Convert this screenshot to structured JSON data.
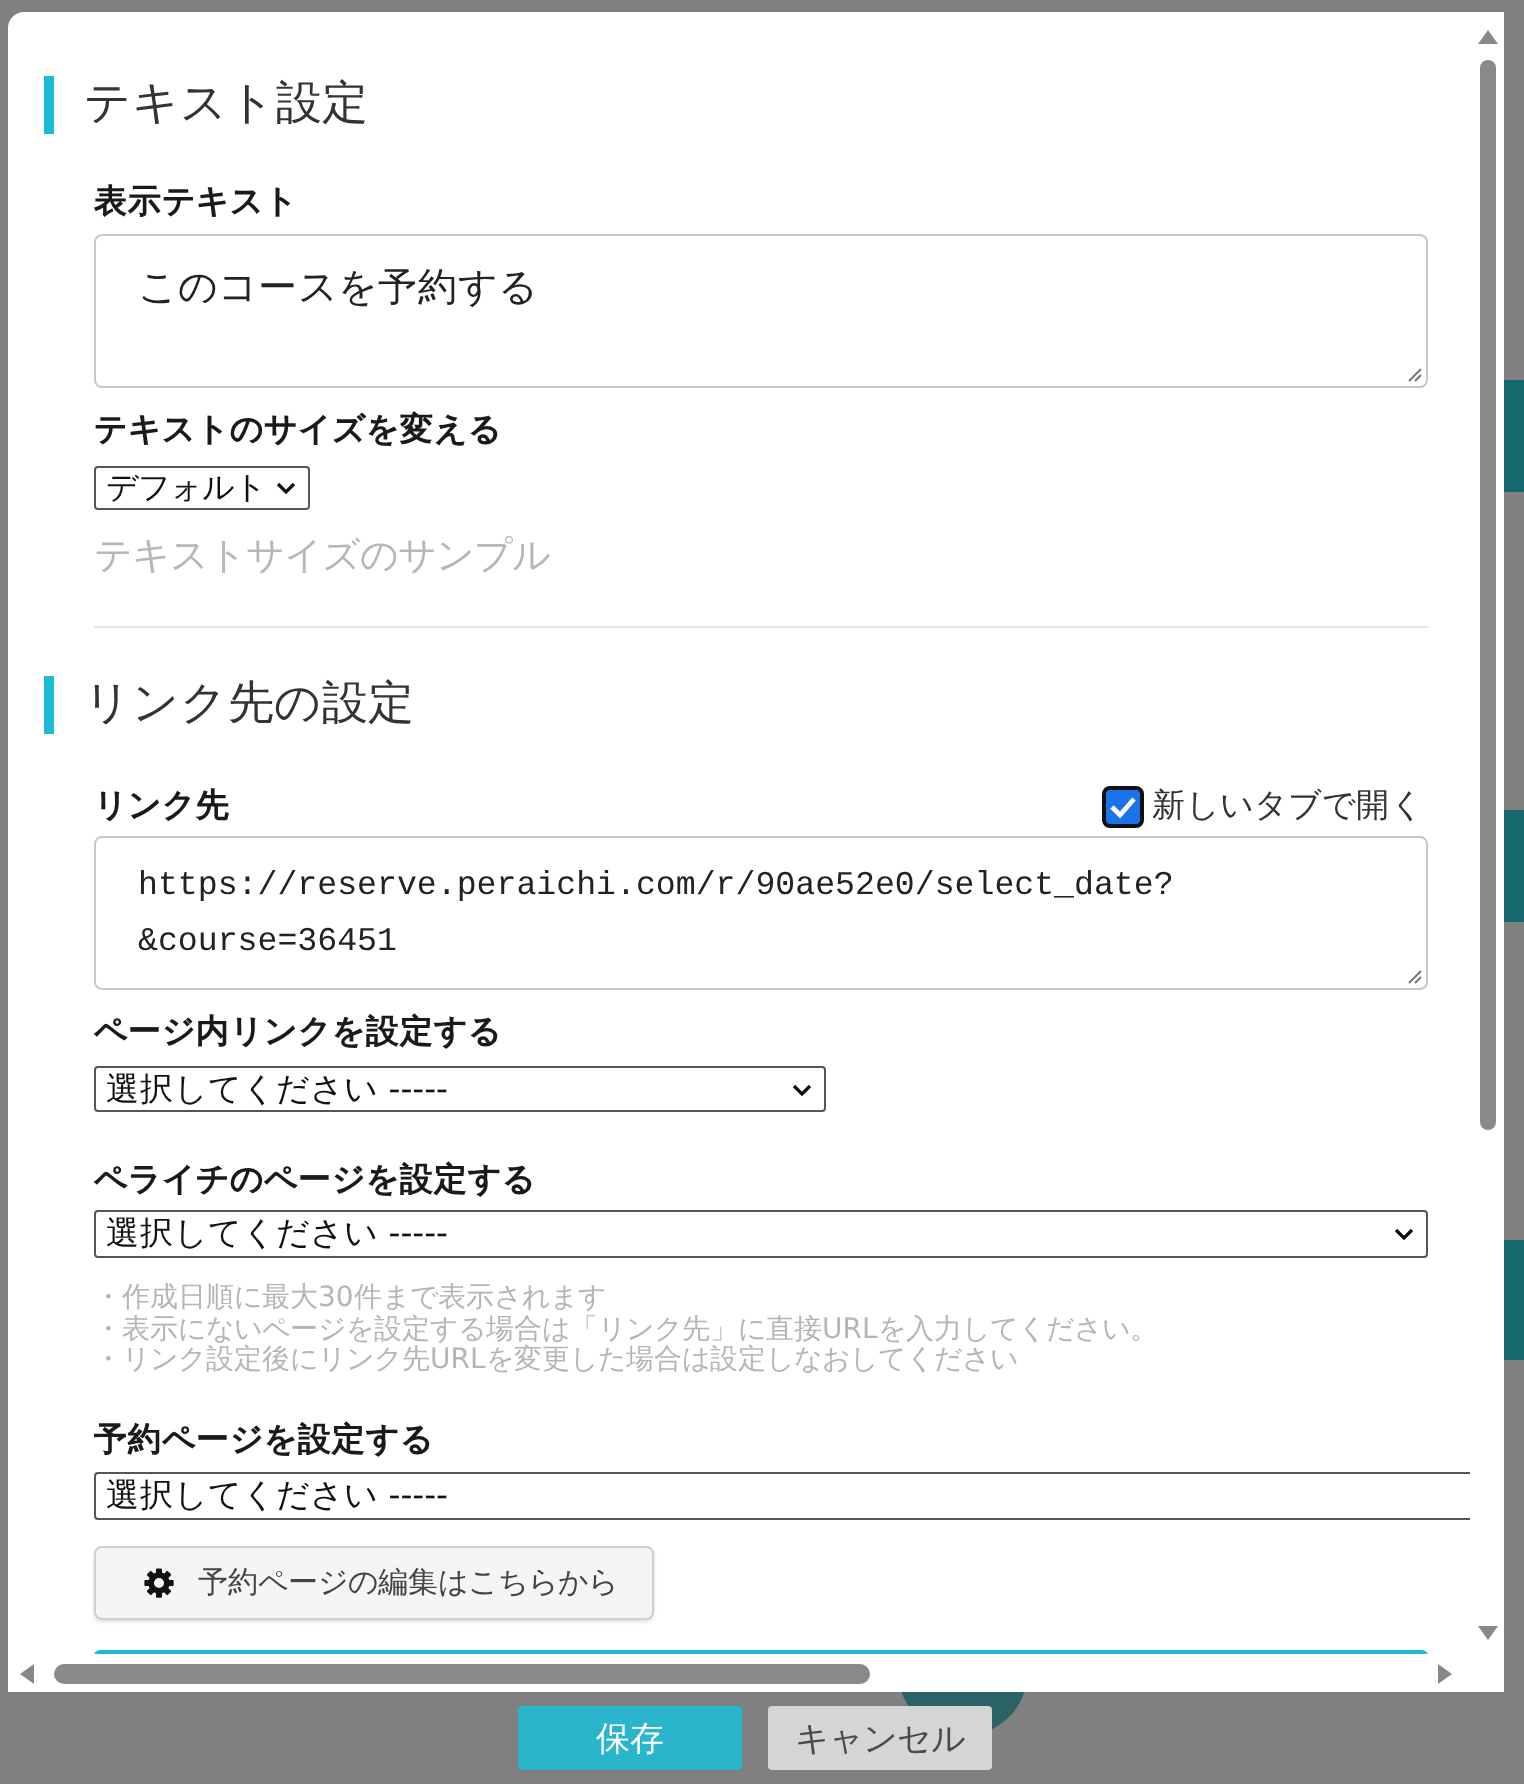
{
  "text_section": {
    "title": "テキスト設定",
    "display_text": {
      "label": "表示テキスト",
      "value": "このコースを予約する"
    },
    "text_size": {
      "label": "テキストのサイズを変える",
      "value": "デフォルト"
    },
    "sample": "テキストサイズのサンプル"
  },
  "link_section": {
    "title": "リンク先の設定",
    "link": {
      "label": "リンク先",
      "new_tab": {
        "label": "新しいタブで開く",
        "checked": true
      },
      "value": "https://reserve.peraichi.com/r/90ae52e0/select_date?&course=36451"
    },
    "page_anchor": {
      "label": "ページ内リンクを設定する",
      "value": "選択してください -----"
    },
    "peraichi_page": {
      "label": "ペライチのページを設定する",
      "value": "選択してください -----"
    },
    "notes": [
      "・作成日順に最大30件まで表示されます",
      "・表示にないページを設定する場合は「リンク先」に直接URLを入力してください。",
      "・リンク設定後にリンク先URLを変更した場合は設定しなおしてください"
    ],
    "reservation_page": {
      "label": "予約ページを設定する",
      "value": "選択してください -----"
    },
    "edit_button": {
      "label": "予約ページの編集はこちらから"
    }
  },
  "footer": {
    "buttons": [
      {
        "label": "保存",
        "kind": "primary"
      },
      {
        "label": "キャンセル",
        "kind": "secondary"
      }
    ]
  }
}
